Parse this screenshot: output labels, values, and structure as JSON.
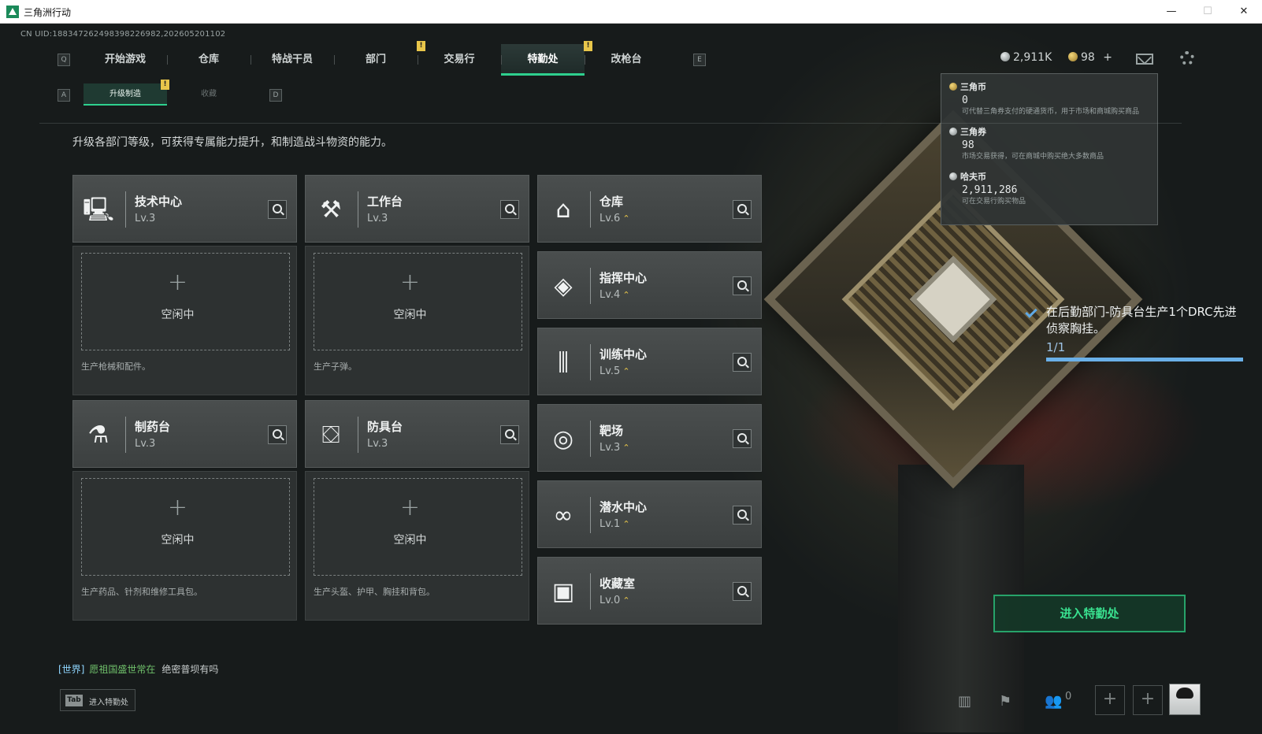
{
  "window": {
    "title": "三角洲行动",
    "minimize": "—",
    "maximize": "☐",
    "close": "✕"
  },
  "uid": "CN UID:188347262498398226982,202605201102",
  "nav": {
    "key_left": "Q",
    "key_right": "E",
    "tabs": [
      "开始游戏",
      "仓库",
      "特战干员",
      "部门",
      "交易行",
      "特勤处",
      "改枪台"
    ],
    "active": "特勤处",
    "badge": "!"
  },
  "subnav": {
    "key_left": "A",
    "key_right": "D",
    "tabs": [
      "升级制造",
      "收藏"
    ],
    "active": "升级制造",
    "badge": "!"
  },
  "currencies": {
    "silver": "2,911K",
    "gold": "98",
    "gold_add": "+"
  },
  "tooltip": {
    "items": [
      {
        "name": "三角币",
        "amount": "0",
        "desc": "可代替三角券支付的硬通货币，用于市场和商城购买商品"
      },
      {
        "name": "三角券",
        "amount": "98",
        "desc": "市场交易获得，可在商城中购买绝大多数商品"
      },
      {
        "name": "哈夫币",
        "amount": "2,911,286",
        "desc": "可在交易行购买物品"
      }
    ]
  },
  "headline": "升级各部门等级，可获得专属能力提升，和制造战斗物资的能力。",
  "departments": [
    {
      "name": "技术中心",
      "level": "Lv.3",
      "icon": "computer-icon"
    },
    {
      "name": "工作台",
      "level": "Lv.3",
      "icon": "tools-icon"
    },
    {
      "name": "仓库",
      "level": "Lv.6",
      "icon": "warehouse-icon",
      "upgradable": true
    },
    {
      "name": "指挥中心",
      "level": "Lv.4",
      "icon": "command-icon",
      "upgradable": true
    },
    {
      "name": "训练中心",
      "level": "Lv.5",
      "icon": "dumbbell-icon",
      "upgradable": true
    },
    {
      "name": "制药台",
      "level": "Lv.3",
      "icon": "microscope-icon"
    },
    {
      "name": "防具台",
      "level": "Lv.3",
      "icon": "armor-icon"
    },
    {
      "name": "靶场",
      "level": "Lv.3",
      "icon": "target-icon",
      "upgradable": true
    },
    {
      "name": "潜水中心",
      "level": "Lv.1",
      "icon": "diving-icon",
      "upgradable": true
    },
    {
      "name": "收藏室",
      "level": "Lv.0",
      "icon": "collection-icon",
      "upgradable": true
    }
  ],
  "slots": [
    {
      "status": "空闲中",
      "desc": "生产枪械和配件。"
    },
    {
      "status": "空闲中",
      "desc": "生产子弹。"
    },
    {
      "status": "空闲中",
      "desc": "生产药品、针剂和维修工具包。"
    },
    {
      "status": "空闲中",
      "desc": "生产头盔、护甲、胸挂和背包。"
    }
  ],
  "slot_plus": "+",
  "upgrade_mark": "⌃",
  "quest": {
    "text": "在后勤部门-防具台生产1个DRC先进侦察胸挂。",
    "progress": "1/1",
    "fraction": 1.0
  },
  "enter_button": "进入特勤处",
  "chat": {
    "channel": "[世界]",
    "user": "愿祖国盛世常在",
    "message": "绝密普坝有吗"
  },
  "tab_hint": {
    "key": "Tab",
    "label": "进入特勤处"
  },
  "friends": {
    "count": "0"
  },
  "add_slot": "+",
  "colors": {
    "accent": "#2ed08e",
    "badge": "#e8c64a",
    "quest_bar": "#6ab0e8"
  }
}
